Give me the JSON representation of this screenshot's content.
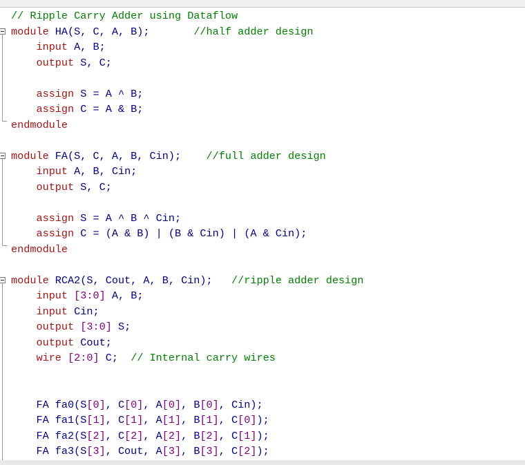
{
  "editor": {
    "lines": [
      [
        {
          "c": "comment",
          "t": "// Ripple Carry Adder using Dataflow"
        }
      ],
      [
        {
          "c": "kw",
          "t": "module"
        },
        {
          "c": "plain",
          "t": " HA(S, C, A, B);       "
        },
        {
          "c": "comment",
          "t": "//half adder design"
        }
      ],
      [
        {
          "c": "plain",
          "t": "    "
        },
        {
          "c": "kw",
          "t": "input"
        },
        {
          "c": "plain",
          "t": " A, B;"
        }
      ],
      [
        {
          "c": "plain",
          "t": "    "
        },
        {
          "c": "kw",
          "t": "output"
        },
        {
          "c": "plain",
          "t": " S, C;"
        }
      ],
      [
        {
          "c": "plain",
          "t": ""
        }
      ],
      [
        {
          "c": "plain",
          "t": "    "
        },
        {
          "c": "kw",
          "t": "assign"
        },
        {
          "c": "plain",
          "t": " S = A ^ B;"
        }
      ],
      [
        {
          "c": "plain",
          "t": "    "
        },
        {
          "c": "kw",
          "t": "assign"
        },
        {
          "c": "plain",
          "t": " C = A & B;"
        }
      ],
      [
        {
          "c": "kw",
          "t": "endmodule"
        }
      ],
      [
        {
          "c": "plain",
          "t": ""
        }
      ],
      [
        {
          "c": "kw",
          "t": "module"
        },
        {
          "c": "plain",
          "t": " FA(S, C, A, B, Cin);    "
        },
        {
          "c": "comment",
          "t": "//full adder design"
        }
      ],
      [
        {
          "c": "plain",
          "t": "    "
        },
        {
          "c": "kw",
          "t": "input"
        },
        {
          "c": "plain",
          "t": " A, B, Cin;"
        }
      ],
      [
        {
          "c": "plain",
          "t": "    "
        },
        {
          "c": "kw",
          "t": "output"
        },
        {
          "c": "plain",
          "t": " S, C;"
        }
      ],
      [
        {
          "c": "plain",
          "t": ""
        }
      ],
      [
        {
          "c": "plain",
          "t": "    "
        },
        {
          "c": "kw",
          "t": "assign"
        },
        {
          "c": "plain",
          "t": " S = A ^ B ^ Cin;"
        }
      ],
      [
        {
          "c": "plain",
          "t": "    "
        },
        {
          "c": "kw",
          "t": "assign"
        },
        {
          "c": "plain",
          "t": " C = (A & B) | (B & Cin) | (A & Cin);"
        }
      ],
      [
        {
          "c": "kw",
          "t": "endmodule"
        }
      ],
      [
        {
          "c": "plain",
          "t": ""
        }
      ],
      [
        {
          "c": "kw",
          "t": "module"
        },
        {
          "c": "plain",
          "t": " RCA2(S, Cout, A, B, Cin);   "
        },
        {
          "c": "comment",
          "t": "//ripple adder design"
        }
      ],
      [
        {
          "c": "plain",
          "t": "    "
        },
        {
          "c": "kw",
          "t": "input"
        },
        {
          "c": "plain",
          "t": " "
        },
        {
          "c": "num",
          "t": "[3:0]"
        },
        {
          "c": "plain",
          "t": " A, B;"
        }
      ],
      [
        {
          "c": "plain",
          "t": "    "
        },
        {
          "c": "kw",
          "t": "input"
        },
        {
          "c": "plain",
          "t": " Cin;"
        }
      ],
      [
        {
          "c": "plain",
          "t": "    "
        },
        {
          "c": "kw",
          "t": "output"
        },
        {
          "c": "plain",
          "t": " "
        },
        {
          "c": "num",
          "t": "[3:0]"
        },
        {
          "c": "plain",
          "t": " S;"
        }
      ],
      [
        {
          "c": "plain",
          "t": "    "
        },
        {
          "c": "kw",
          "t": "output"
        },
        {
          "c": "plain",
          "t": " Cout;"
        }
      ],
      [
        {
          "c": "plain",
          "t": "    "
        },
        {
          "c": "kw",
          "t": "wire"
        },
        {
          "c": "plain",
          "t": " "
        },
        {
          "c": "num",
          "t": "[2:0]"
        },
        {
          "c": "plain",
          "t": " C;  "
        },
        {
          "c": "comment",
          "t": "// Internal carry wires"
        }
      ],
      [
        {
          "c": "plain",
          "t": ""
        }
      ],
      [
        {
          "c": "plain",
          "t": ""
        }
      ],
      [
        {
          "c": "plain",
          "t": "    FA fa0(S"
        },
        {
          "c": "num",
          "t": "[0]"
        },
        {
          "c": "plain",
          "t": ", C"
        },
        {
          "c": "num",
          "t": "[0]"
        },
        {
          "c": "plain",
          "t": ", A"
        },
        {
          "c": "num",
          "t": "[0]"
        },
        {
          "c": "plain",
          "t": ", B"
        },
        {
          "c": "num",
          "t": "[0]"
        },
        {
          "c": "plain",
          "t": ", Cin);"
        }
      ],
      [
        {
          "c": "plain",
          "t": "    FA fa1(S"
        },
        {
          "c": "num",
          "t": "[1]"
        },
        {
          "c": "plain",
          "t": ", C"
        },
        {
          "c": "num",
          "t": "[1]"
        },
        {
          "c": "plain",
          "t": ", A"
        },
        {
          "c": "num",
          "t": "[1]"
        },
        {
          "c": "plain",
          "t": ", B"
        },
        {
          "c": "num",
          "t": "[1]"
        },
        {
          "c": "plain",
          "t": ", C"
        },
        {
          "c": "num",
          "t": "[0]"
        },
        {
          "c": "plain",
          "t": ");"
        }
      ],
      [
        {
          "c": "plain",
          "t": "    FA fa2(S"
        },
        {
          "c": "num",
          "t": "[2]"
        },
        {
          "c": "plain",
          "t": ", C"
        },
        {
          "c": "num",
          "t": "[2]"
        },
        {
          "c": "plain",
          "t": ", A"
        },
        {
          "c": "num",
          "t": "[2]"
        },
        {
          "c": "plain",
          "t": ", B"
        },
        {
          "c": "num",
          "t": "[2]"
        },
        {
          "c": "plain",
          "t": ", C"
        },
        {
          "c": "num",
          "t": "[1]"
        },
        {
          "c": "plain",
          "t": ");"
        }
      ],
      [
        {
          "c": "plain",
          "t": "    FA fa3(S"
        },
        {
          "c": "num",
          "t": "[3]"
        },
        {
          "c": "plain",
          "t": ", Cout, A"
        },
        {
          "c": "num",
          "t": "[3]"
        },
        {
          "c": "plain",
          "t": ", B"
        },
        {
          "c": "num",
          "t": "[3]"
        },
        {
          "c": "plain",
          "t": ", C"
        },
        {
          "c": "num",
          "t": "[2]"
        },
        {
          "c": "plain",
          "t": ");"
        }
      ]
    ],
    "colors": {
      "comment": "#008000",
      "keyword": "#a31515",
      "identifier": "#000080",
      "number": "#800080"
    },
    "fold_markers": [
      "collapse-icon",
      "collapse-icon",
      "collapse-icon"
    ]
  }
}
